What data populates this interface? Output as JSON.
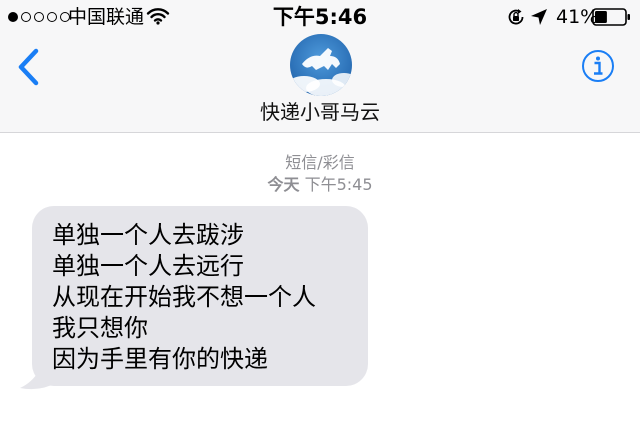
{
  "status_bar": {
    "carrier": "中国联通",
    "time": "下午5:46",
    "battery_percent": "41%",
    "battery_level": 0.41,
    "signal_bars_filled": 1,
    "signal_bars_total": 5,
    "icons": [
      "wifi-icon",
      "rotation-lock-icon",
      "location-arrow-icon",
      "battery-icon"
    ]
  },
  "nav": {
    "contact_name": "快递小哥马云",
    "back_icon": "chevron-left-icon",
    "info_icon": "info-icon",
    "accent_color": "#1a7ef5"
  },
  "thread_meta": {
    "type_label": "短信/彩信",
    "day": "今天",
    "time": "下午5:45"
  },
  "messages": [
    {
      "direction": "incoming",
      "bubble_color": "#e5e5ea",
      "lines": [
        "单独一个人去跋涉",
        "单独一个人去远行",
        "从现在开始我不想一个人",
        "我只想你",
        "因为手里有你的快递"
      ]
    }
  ]
}
